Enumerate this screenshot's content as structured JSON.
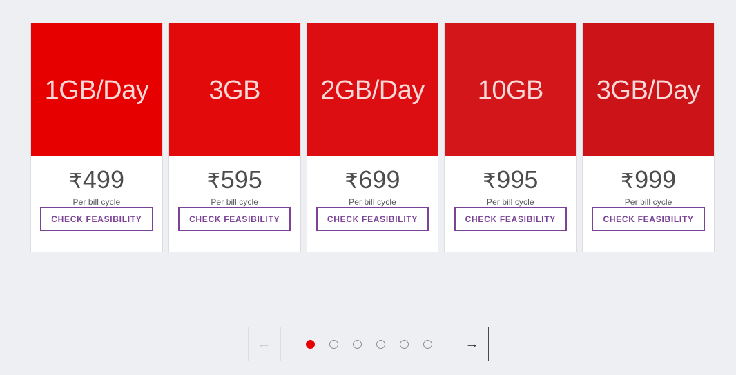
{
  "page": {
    "background_color": "#eeeff2"
  },
  "carousel": {
    "cards": [
      {
        "title": "1GB/Day",
        "header_color": "#e60000",
        "currency": "₹",
        "price": "499",
        "period": "Per bill cycle",
        "cta_label": "CHECK FEASIBILITY"
      },
      {
        "title": "3GB",
        "header_color": "#e20a0a",
        "currency": "₹",
        "price": "595",
        "period": "Per bill cycle",
        "cta_label": "CHECK FEASIBILITY"
      },
      {
        "title": "2GB/Day",
        "header_color": "#dd0e12",
        "currency": "₹",
        "price": "699",
        "period": "Per bill cycle",
        "cta_label": "CHECK FEASIBILITY"
      },
      {
        "title": "10GB",
        "header_color": "#d2161a",
        "currency": "₹",
        "price": "995",
        "period": "Per bill cycle",
        "cta_label": "CHECK FEASIBILITY"
      },
      {
        "title": "3GB/Day",
        "header_color": "#cc1418",
        "currency": "₹",
        "price": "999",
        "period": "Per bill cycle",
        "cta_label": "CHECK FEASIBILITY"
      }
    ],
    "cta_color": "#7b4397"
  },
  "pager": {
    "prev_icon": "←",
    "prev_enabled": "false",
    "next_icon": "→",
    "next_enabled": "true",
    "active_index": 0,
    "active_color": "#e60000",
    "dot_count": 6,
    "dots": [
      {
        "index": "1",
        "active": true
      },
      {
        "index": "2",
        "active": false
      },
      {
        "index": "3",
        "active": false
      },
      {
        "index": "4",
        "active": false
      },
      {
        "index": "5",
        "active": false
      },
      {
        "index": "6",
        "active": false
      }
    ]
  }
}
